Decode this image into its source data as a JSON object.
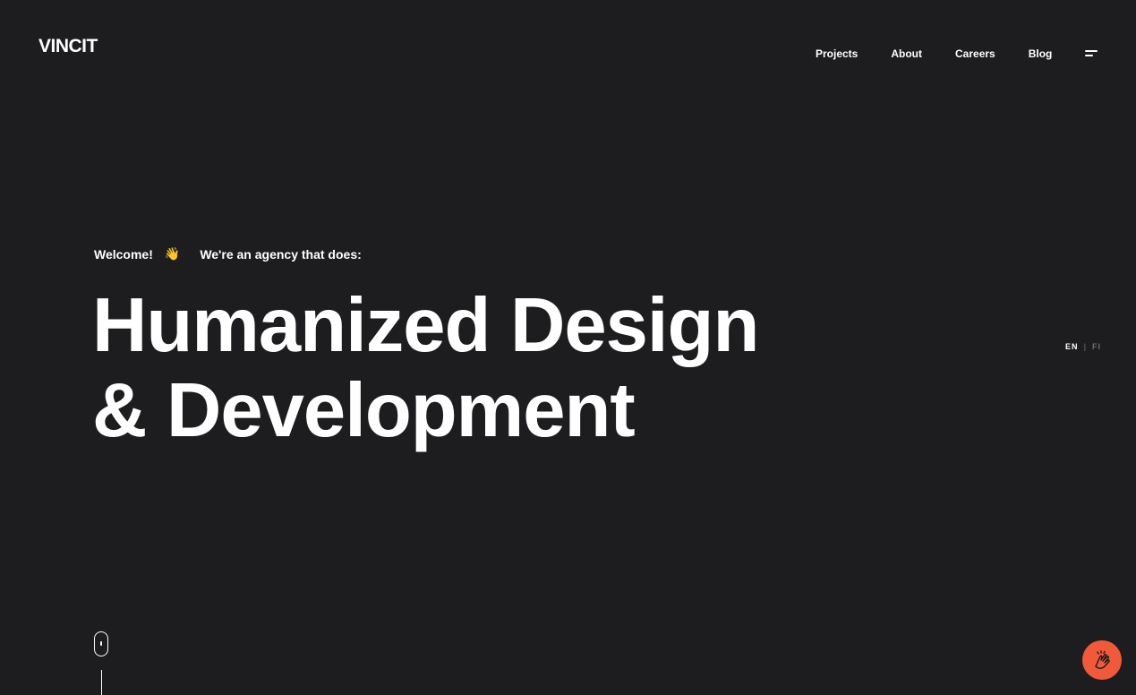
{
  "header": {
    "logo_text": "VINCIT",
    "nav": {
      "projects": "Projects",
      "about": "About",
      "careers": "Careers",
      "blog": "Blog"
    },
    "menu_icon": "hamburger-menu-icon"
  },
  "hero": {
    "welcome": "Welcome!",
    "wave_emoji": "👋",
    "tagline": "We're an agency that does:",
    "headline_line1": "Humanized Design",
    "headline_line2": "& Development"
  },
  "language": {
    "active": "EN",
    "separator": "|",
    "other": "FI"
  },
  "icons": {
    "scroll": "scroll-mouse-icon",
    "chat": "clapping-hands-icon"
  },
  "colors": {
    "background": "#1d1d1f",
    "text": "#ffffff",
    "accent": "#f05a3a",
    "muted": "#6d6d70"
  }
}
